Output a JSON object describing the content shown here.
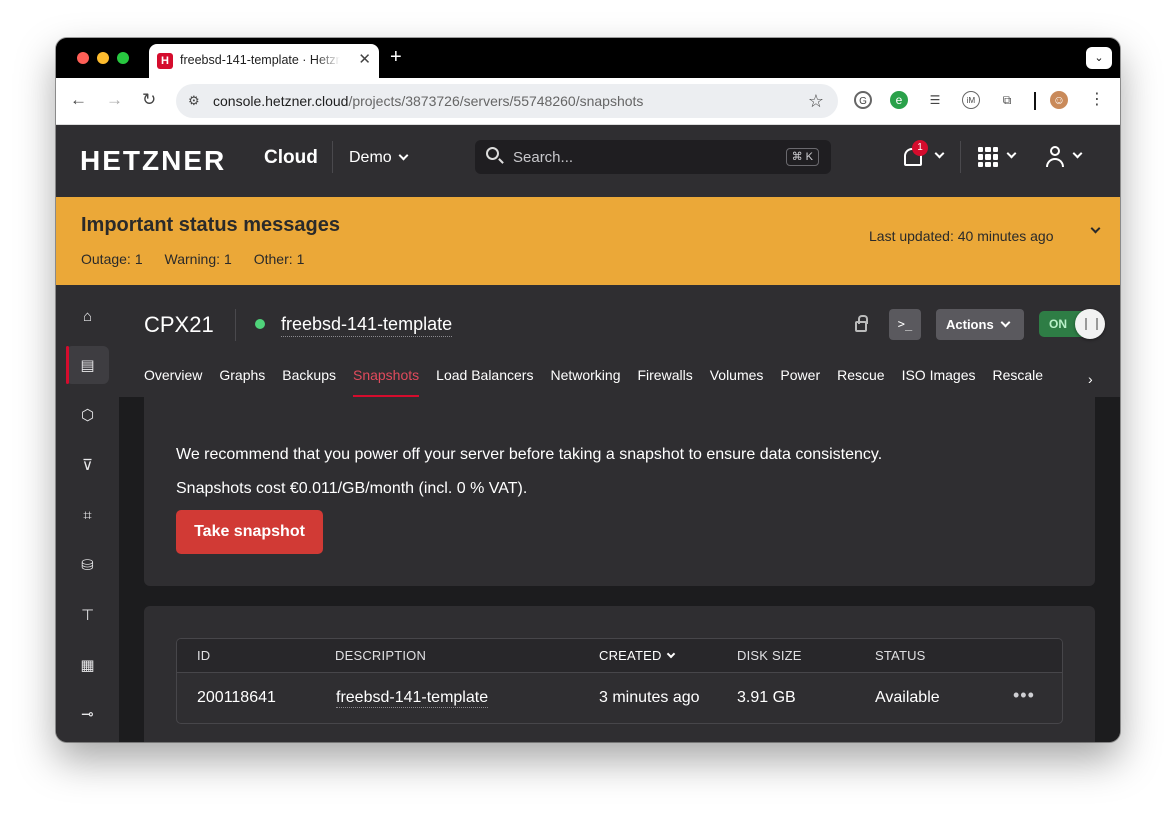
{
  "browser": {
    "tab_title": "freebsd-141-template · Hetzner Cloud",
    "url_host": "console.hetzner.cloud",
    "url_path": "/projects/3873726/servers/55748260/snapshots"
  },
  "header": {
    "logo": "HETZNER",
    "product": "Cloud",
    "project": "Demo",
    "search_placeholder": "Search...",
    "shortcut": "⌘ K",
    "notification_count": "1"
  },
  "banner": {
    "title": "Important status messages",
    "outage_label": "Outage:",
    "outage_count": "1",
    "warning_label": "Warning:",
    "warning_count": "1",
    "other_label": "Other:",
    "other_count": "1",
    "updated_label": "Last updated:",
    "updated_value": "40 minutes ago"
  },
  "sidebar": {
    "items": [
      {
        "icon": "home-icon"
      },
      {
        "icon": "servers-icon",
        "active": true
      },
      {
        "icon": "box-icon"
      },
      {
        "icon": "bucket-icon"
      },
      {
        "icon": "network-icon"
      },
      {
        "icon": "storage-icon"
      },
      {
        "icon": "load-balancer-icon"
      },
      {
        "icon": "firewall-icon"
      },
      {
        "icon": "key-icon"
      }
    ]
  },
  "server": {
    "type": "CPX21",
    "name": "freebsd-141-template",
    "status_color": "#4fd37a",
    "console_label": ">_",
    "actions_label": "Actions",
    "power_label": "ON"
  },
  "tabs": [
    {
      "label": "Overview"
    },
    {
      "label": "Graphs"
    },
    {
      "label": "Backups"
    },
    {
      "label": "Snapshots",
      "active": true
    },
    {
      "label": "Load Balancers"
    },
    {
      "label": "Networking"
    },
    {
      "label": "Firewalls"
    },
    {
      "label": "Volumes"
    },
    {
      "label": "Power"
    },
    {
      "label": "Rescue"
    },
    {
      "label": "ISO Images"
    },
    {
      "label": "Rescale"
    }
  ],
  "snapshot_intro": {
    "recommendation": "We recommend that you power off your server before taking a snapshot to ensure data consistency.",
    "cost": "Snapshots cost €0.011/GB/month (incl. 0 % VAT).",
    "button": "Take snapshot"
  },
  "table": {
    "columns": [
      "ID",
      "DESCRIPTION",
      "CREATED",
      "DISK SIZE",
      "STATUS"
    ],
    "rows": [
      {
        "id": "200118641",
        "description": "freebsd-141-template",
        "created": "3 minutes ago",
        "disk_size": "3.91 GB",
        "status": "Available"
      }
    ]
  },
  "colors": {
    "brand_red": "#d50c2d",
    "banner_amber": "#eba838",
    "header_bg": "#2f2e31",
    "button_red": "#d13a35"
  }
}
